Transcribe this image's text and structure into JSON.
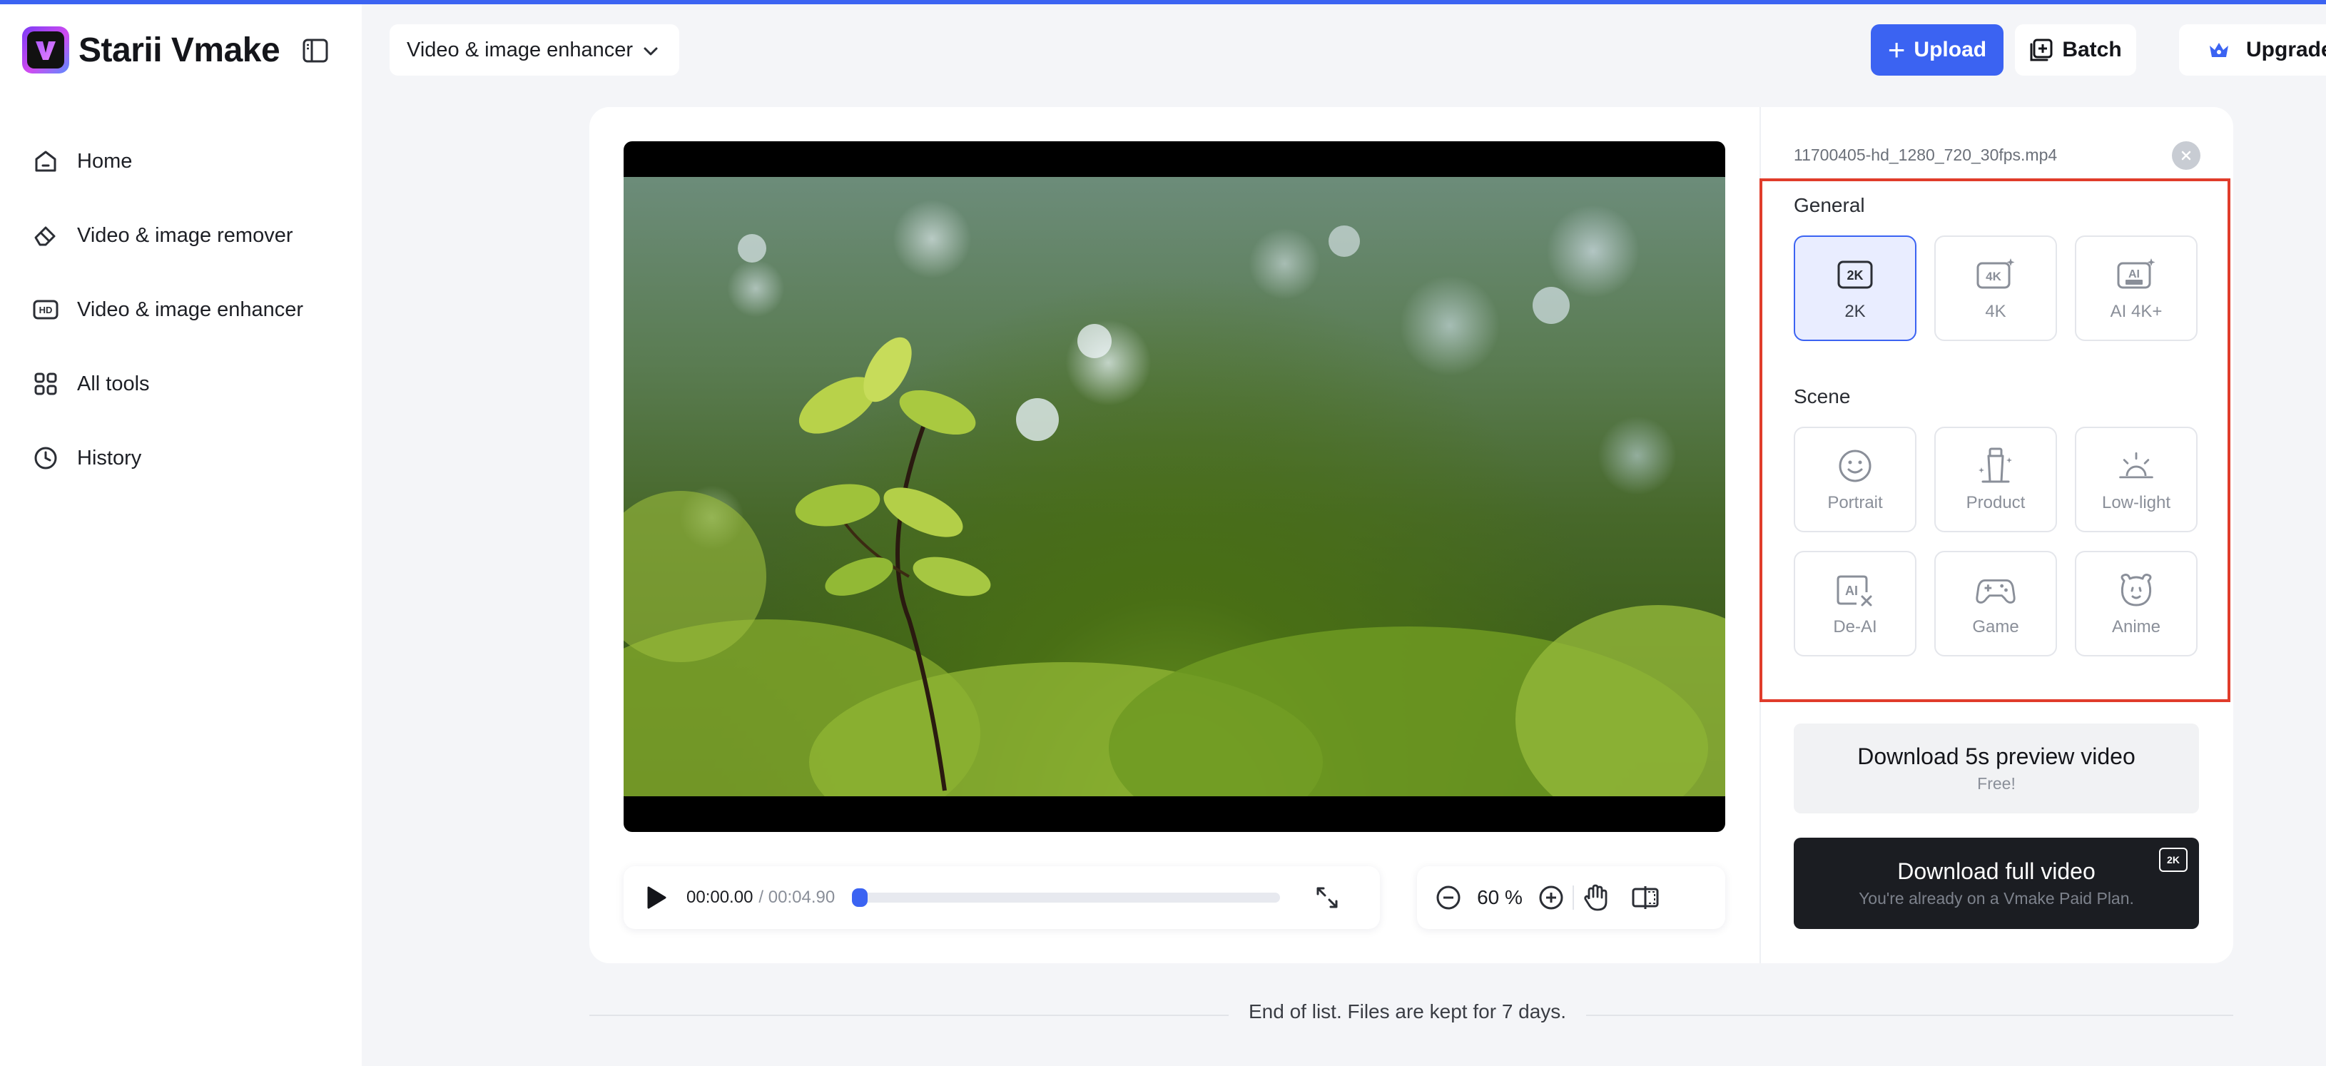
{
  "app": {
    "brand_name": "Starii Vmake",
    "accent_color": "#3b63f2",
    "highlight_color": "#e03c2b"
  },
  "sidebar": {
    "items": [
      {
        "label": "Home",
        "icon": "home-icon"
      },
      {
        "label": "Video & image remover",
        "icon": "eraser-icon"
      },
      {
        "label": "Video & image enhancer",
        "icon": "hd-icon"
      },
      {
        "label": "All tools",
        "icon": "grid-icon"
      },
      {
        "label": "History",
        "icon": "clock-icon"
      }
    ]
  },
  "header": {
    "tool_select_value": "Video & image enhancer",
    "upload_label": "Upload",
    "batch_label": "Batch",
    "upgrade_label": "Upgrade"
  },
  "player": {
    "current_time": "00:00.00",
    "duration": "/ 00:04.90",
    "progress_fraction": 0.0,
    "zoom": "60 %"
  },
  "panel": {
    "filename": "11700405-hd_1280_720_30fps.mp4",
    "general_title": "General",
    "general_options": [
      {
        "label": "2K",
        "icon": "2k-icon",
        "selected": true
      },
      {
        "label": "4K",
        "icon": "4k-sparkle-icon",
        "selected": false
      },
      {
        "label": "AI 4K+",
        "icon": "ai-ultra-icon",
        "selected": false
      }
    ],
    "scene_title": "Scene",
    "scene_options": [
      {
        "label": "Portrait",
        "icon": "smiley-face-icon"
      },
      {
        "label": "Product",
        "icon": "product-bottle-icon"
      },
      {
        "label": "Low-light",
        "icon": "sunrise-icon"
      },
      {
        "label": "De-AI",
        "icon": "ai-remove-icon"
      },
      {
        "label": "Game",
        "icon": "gamepad-icon"
      },
      {
        "label": "Anime",
        "icon": "bear-face-icon"
      }
    ],
    "download_preview": {
      "title": "Download 5s preview video",
      "subtitle": "Free!"
    },
    "download_full": {
      "title": "Download full video",
      "subtitle": "You're already on a Vmake Paid Plan.",
      "badge": "2K"
    }
  },
  "footer": {
    "text": "End of list. Files are kept for 7 days."
  }
}
